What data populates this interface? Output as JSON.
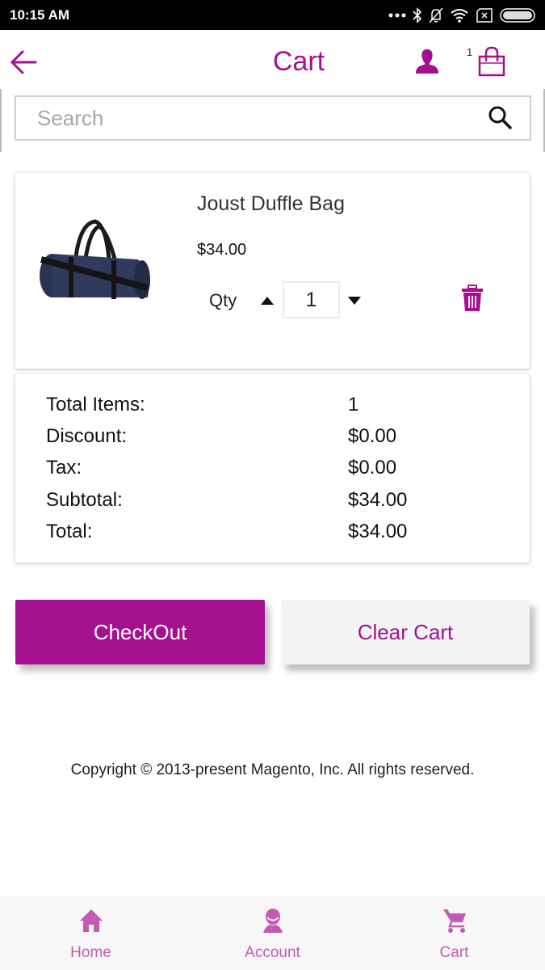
{
  "status_bar": {
    "time": "10:15 AM",
    "icons": [
      "more-dots-icon",
      "bluetooth-icon",
      "notifications-off-icon",
      "wifi-icon",
      "sim-off-icon",
      "battery-icon"
    ]
  },
  "header": {
    "title": "Cart",
    "back_icon": "arrow-left-icon",
    "account_icon": "person-icon",
    "cart_badge_count": "1",
    "cart_icon": "shopping-bag-icon"
  },
  "search": {
    "placeholder": "Search",
    "value": "",
    "icon": "search-icon"
  },
  "cart_items": [
    {
      "name": "Joust Duffle Bag",
      "price": "$34.00",
      "qty_label": "Qty",
      "quantity": "1",
      "image": "navy duffle bag"
    }
  ],
  "summary": {
    "rows": [
      {
        "label": "Total Items:",
        "value": "1"
      },
      {
        "label": "Discount:",
        "value": "$0.00"
      },
      {
        "label": "Tax:",
        "value": "$0.00"
      },
      {
        "label": "Subtotal:",
        "value": "$34.00"
      },
      {
        "label": "Total:",
        "value": "$34.00"
      }
    ]
  },
  "actions": {
    "checkout_label": "CheckOut",
    "clear_label": "Clear Cart"
  },
  "footer": {
    "copyright": "Copyright © 2013-present Magento, Inc. All rights reserved."
  },
  "bottom_nav": {
    "items": [
      {
        "label": "Home",
        "icon": "home-icon"
      },
      {
        "label": "Account",
        "icon": "account-icon"
      },
      {
        "label": "Cart",
        "icon": "cart-icon"
      }
    ]
  },
  "colors": {
    "brand": "#a5108f",
    "nav_accent": "#c45ab3",
    "secondary_button_bg": "#f4f4f4"
  }
}
